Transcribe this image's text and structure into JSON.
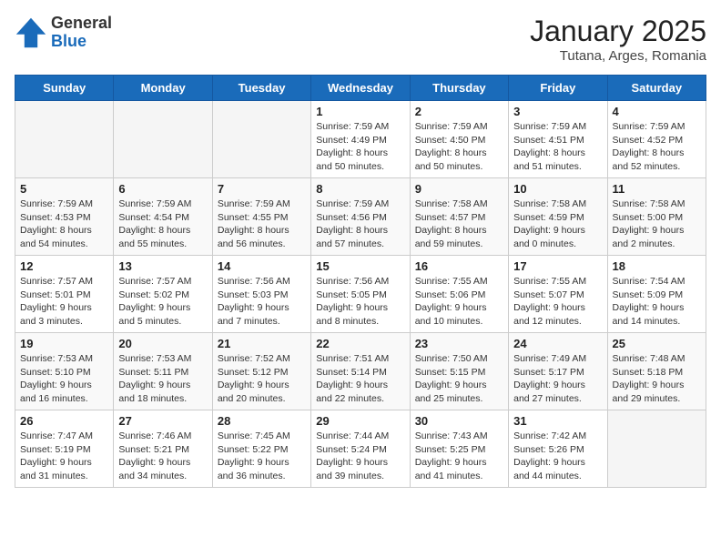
{
  "logo": {
    "general": "General",
    "blue": "Blue"
  },
  "header": {
    "month": "January 2025",
    "location": "Tutana, Arges, Romania"
  },
  "weekdays": [
    "Sunday",
    "Monday",
    "Tuesday",
    "Wednesday",
    "Thursday",
    "Friday",
    "Saturday"
  ],
  "weeks": [
    [
      {
        "day": "",
        "info": ""
      },
      {
        "day": "",
        "info": ""
      },
      {
        "day": "",
        "info": ""
      },
      {
        "day": "1",
        "info": "Sunrise: 7:59 AM\nSunset: 4:49 PM\nDaylight: 8 hours\nand 50 minutes."
      },
      {
        "day": "2",
        "info": "Sunrise: 7:59 AM\nSunset: 4:50 PM\nDaylight: 8 hours\nand 50 minutes."
      },
      {
        "day": "3",
        "info": "Sunrise: 7:59 AM\nSunset: 4:51 PM\nDaylight: 8 hours\nand 51 minutes."
      },
      {
        "day": "4",
        "info": "Sunrise: 7:59 AM\nSunset: 4:52 PM\nDaylight: 8 hours\nand 52 minutes."
      }
    ],
    [
      {
        "day": "5",
        "info": "Sunrise: 7:59 AM\nSunset: 4:53 PM\nDaylight: 8 hours\nand 54 minutes."
      },
      {
        "day": "6",
        "info": "Sunrise: 7:59 AM\nSunset: 4:54 PM\nDaylight: 8 hours\nand 55 minutes."
      },
      {
        "day": "7",
        "info": "Sunrise: 7:59 AM\nSunset: 4:55 PM\nDaylight: 8 hours\nand 56 minutes."
      },
      {
        "day": "8",
        "info": "Sunrise: 7:59 AM\nSunset: 4:56 PM\nDaylight: 8 hours\nand 57 minutes."
      },
      {
        "day": "9",
        "info": "Sunrise: 7:58 AM\nSunset: 4:57 PM\nDaylight: 8 hours\nand 59 minutes."
      },
      {
        "day": "10",
        "info": "Sunrise: 7:58 AM\nSunset: 4:59 PM\nDaylight: 9 hours\nand 0 minutes."
      },
      {
        "day": "11",
        "info": "Sunrise: 7:58 AM\nSunset: 5:00 PM\nDaylight: 9 hours\nand 2 minutes."
      }
    ],
    [
      {
        "day": "12",
        "info": "Sunrise: 7:57 AM\nSunset: 5:01 PM\nDaylight: 9 hours\nand 3 minutes."
      },
      {
        "day": "13",
        "info": "Sunrise: 7:57 AM\nSunset: 5:02 PM\nDaylight: 9 hours\nand 5 minutes."
      },
      {
        "day": "14",
        "info": "Sunrise: 7:56 AM\nSunset: 5:03 PM\nDaylight: 9 hours\nand 7 minutes."
      },
      {
        "day": "15",
        "info": "Sunrise: 7:56 AM\nSunset: 5:05 PM\nDaylight: 9 hours\nand 8 minutes."
      },
      {
        "day": "16",
        "info": "Sunrise: 7:55 AM\nSunset: 5:06 PM\nDaylight: 9 hours\nand 10 minutes."
      },
      {
        "day": "17",
        "info": "Sunrise: 7:55 AM\nSunset: 5:07 PM\nDaylight: 9 hours\nand 12 minutes."
      },
      {
        "day": "18",
        "info": "Sunrise: 7:54 AM\nSunset: 5:09 PM\nDaylight: 9 hours\nand 14 minutes."
      }
    ],
    [
      {
        "day": "19",
        "info": "Sunrise: 7:53 AM\nSunset: 5:10 PM\nDaylight: 9 hours\nand 16 minutes."
      },
      {
        "day": "20",
        "info": "Sunrise: 7:53 AM\nSunset: 5:11 PM\nDaylight: 9 hours\nand 18 minutes."
      },
      {
        "day": "21",
        "info": "Sunrise: 7:52 AM\nSunset: 5:12 PM\nDaylight: 9 hours\nand 20 minutes."
      },
      {
        "day": "22",
        "info": "Sunrise: 7:51 AM\nSunset: 5:14 PM\nDaylight: 9 hours\nand 22 minutes."
      },
      {
        "day": "23",
        "info": "Sunrise: 7:50 AM\nSunset: 5:15 PM\nDaylight: 9 hours\nand 25 minutes."
      },
      {
        "day": "24",
        "info": "Sunrise: 7:49 AM\nSunset: 5:17 PM\nDaylight: 9 hours\nand 27 minutes."
      },
      {
        "day": "25",
        "info": "Sunrise: 7:48 AM\nSunset: 5:18 PM\nDaylight: 9 hours\nand 29 minutes."
      }
    ],
    [
      {
        "day": "26",
        "info": "Sunrise: 7:47 AM\nSunset: 5:19 PM\nDaylight: 9 hours\nand 31 minutes."
      },
      {
        "day": "27",
        "info": "Sunrise: 7:46 AM\nSunset: 5:21 PM\nDaylight: 9 hours\nand 34 minutes."
      },
      {
        "day": "28",
        "info": "Sunrise: 7:45 AM\nSunset: 5:22 PM\nDaylight: 9 hours\nand 36 minutes."
      },
      {
        "day": "29",
        "info": "Sunrise: 7:44 AM\nSunset: 5:24 PM\nDaylight: 9 hours\nand 39 minutes."
      },
      {
        "day": "30",
        "info": "Sunrise: 7:43 AM\nSunset: 5:25 PM\nDaylight: 9 hours\nand 41 minutes."
      },
      {
        "day": "31",
        "info": "Sunrise: 7:42 AM\nSunset: 5:26 PM\nDaylight: 9 hours\nand 44 minutes."
      },
      {
        "day": "",
        "info": ""
      }
    ]
  ]
}
